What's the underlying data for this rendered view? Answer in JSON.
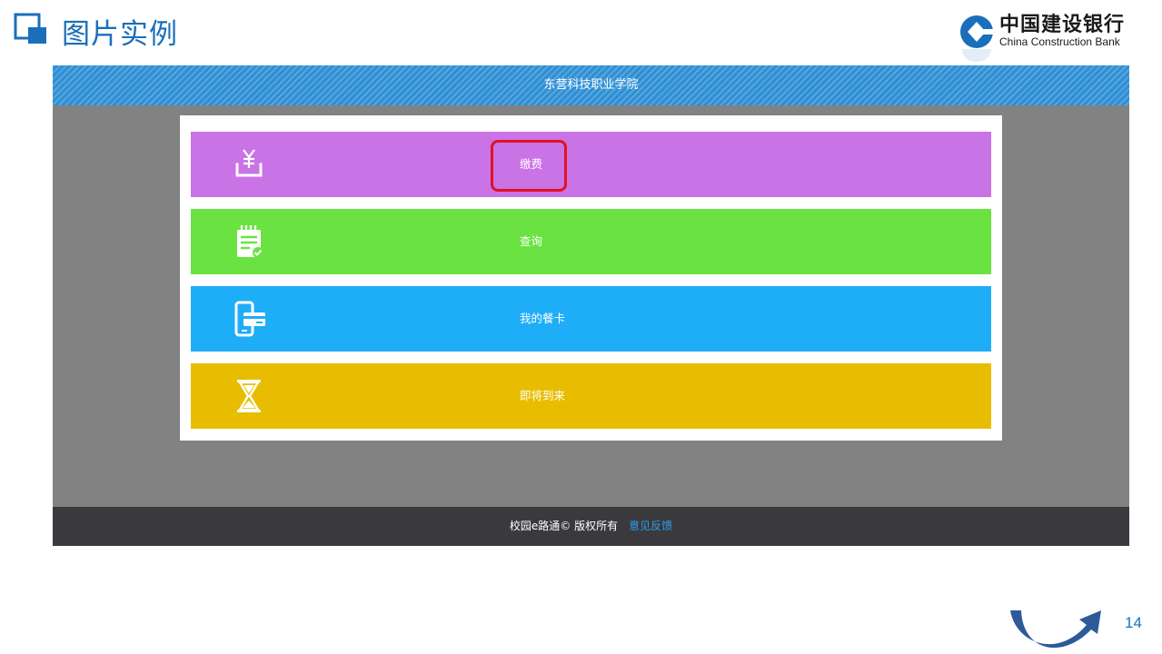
{
  "slide": {
    "title": "图片实例",
    "page_number": "14"
  },
  "logo": {
    "name_cn": "中国建设银行",
    "name_en": "China Construction Bank"
  },
  "app": {
    "header_title": "东营科技职业学院",
    "tiles": [
      {
        "label": "缴费",
        "icon": "yuan-download-icon",
        "color": "#c973e6",
        "highlighted": true
      },
      {
        "label": "查询",
        "icon": "clipboard-check-icon",
        "color": "#6ae342"
      },
      {
        "label": "我的餐卡",
        "icon": "phone-card-icon",
        "color": "#1eaef7"
      },
      {
        "label": "即将到来",
        "icon": "hourglass-icon",
        "color": "#e8bd00"
      }
    ],
    "footer": {
      "copyright": "校园e路通© 版权所有",
      "feedback_link": "意见反馈"
    }
  },
  "colors": {
    "title_blue": "#1a6fba",
    "header_blue": "#2e8fd4",
    "highlight_red": "#e0131f",
    "footer_bg": "#3a393e",
    "feedback_link": "#2f9ee9"
  }
}
